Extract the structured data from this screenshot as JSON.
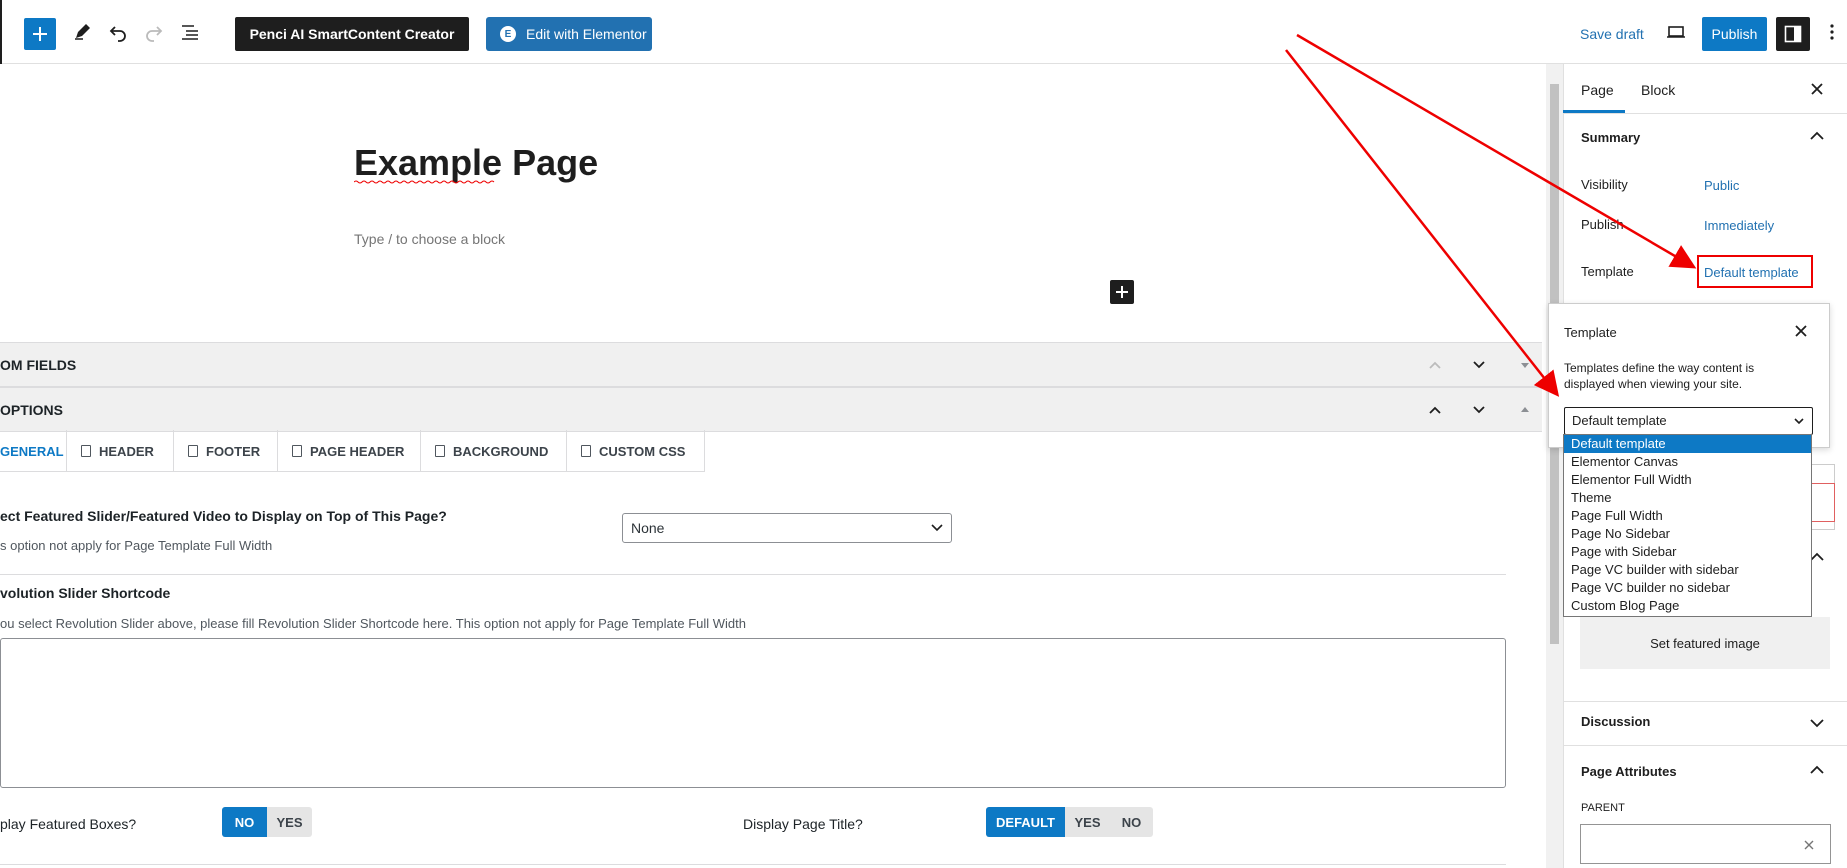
{
  "toolbar": {
    "ai_button": "Penci AI SmartContent Creator",
    "elementor_button": "Edit with Elementor",
    "save_draft": "Save draft",
    "publish": "Publish"
  },
  "editor": {
    "title": "Example Page",
    "placeholder": "Type / to choose a block"
  },
  "meta_boxes": {
    "custom_fields": "OM FIELDS",
    "options": "OPTIONS",
    "tabs": [
      "GENERAL",
      "HEADER",
      "FOOTER",
      "PAGE HEADER",
      "BACKGROUND",
      "CUSTOM CSS"
    ],
    "featured_slider_label": "ect Featured Slider/Featured Video to Display on Top of This Page?",
    "featured_slider_help": "s option not apply for Page Template Full Width",
    "featured_slider_value": "None",
    "rev_slider_label": "volution Slider Shortcode",
    "rev_slider_help": "ou select Revolution Slider above, please fill Revolution Slider Shortcode here. This option not apply for Page Template Full Width",
    "featured_boxes_label": "play Featured Boxes?",
    "featured_boxes_options": [
      "NO",
      "YES"
    ],
    "page_title_label": "Display Page Title?",
    "page_title_options": [
      "DEFAULT",
      "YES",
      "NO"
    ]
  },
  "sidebar": {
    "tab_page": "Page",
    "tab_block": "Block",
    "summary": "Summary",
    "visibility_label": "Visibility",
    "visibility_value": "Public",
    "publish_label": "Publish",
    "publish_value": "Immediately",
    "template_label": "Template",
    "template_value": "Default template",
    "featured_image": "Set featured image",
    "discussion": "Discussion",
    "page_attributes": "Page Attributes",
    "parent": "PARENT"
  },
  "popover": {
    "title": "Template",
    "description_line1": "Templates define the way content is",
    "description_line2": "displayed when viewing your site.",
    "selected": "Default template",
    "options": [
      "Default template",
      "Elementor Canvas",
      "Elementor Full Width",
      "Theme",
      "Page Full Width",
      "Page No Sidebar",
      "Page with Sidebar",
      "Page VC builder with sidebar",
      "Page VC builder no sidebar",
      "Custom Blog Page"
    ]
  },
  "colors": {
    "accent": "#0d79c5",
    "annotation": "#ee0000"
  }
}
